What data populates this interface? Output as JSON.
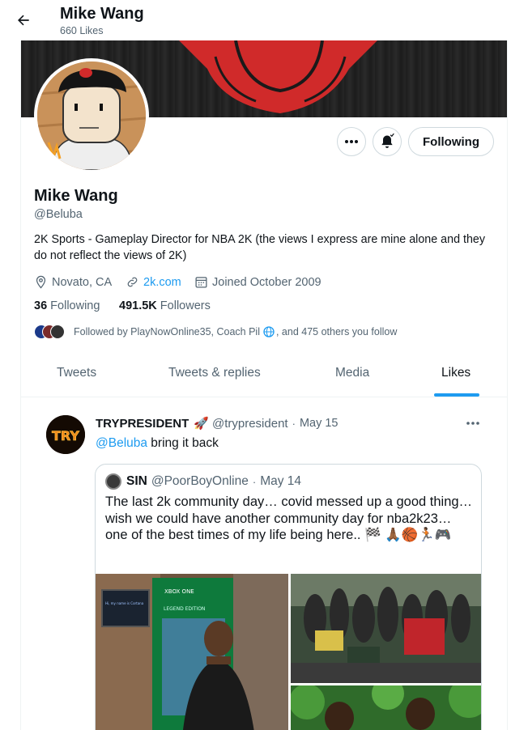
{
  "header": {
    "title": "Mike Wang",
    "likes_count": "660 Likes"
  },
  "profile": {
    "name": "Mike Wang",
    "handle": "@Beluba",
    "bio": "2K Sports - Gameplay Director for NBA 2K (the views I express are mine alone and they do not reflect the views of 2K)",
    "location": "Novato, CA",
    "website": "2k.com",
    "joined": "Joined October 2009",
    "following_count": "36",
    "following_label": "Following",
    "followers_count": "491.5K",
    "followers_label": "Followers",
    "followed_by": "Followed by PlayNowOnline35, Coach Pil",
    "followed_by_tail": ", and 475 others you follow",
    "follow_button_label": "Following"
  },
  "tabs": [
    {
      "label": "Tweets",
      "active": false
    },
    {
      "label": "Tweets & replies",
      "active": false
    },
    {
      "label": "Media",
      "active": false
    },
    {
      "label": "Likes",
      "active": true
    }
  ],
  "tweet": {
    "author_name": "TRYPRESIDENT",
    "author_handle": "@trypresident",
    "separator": "·",
    "date": "May 15",
    "mention": "@Beluba",
    "text": " bring it back",
    "avatar_text": "TRY",
    "quote": {
      "author_name": "SIN",
      "author_handle": "@PoorBoyOnline",
      "separator": "·",
      "date": "May 14",
      "text": "The last 2k community day… covid messed up a good thing… wish we could have another community day for nba2k23… one of the best times of my life being here.. 🏁 🙏🏾🏀🏃🏾🎮",
      "sign_text": "XBOX ONE",
      "sign_title": "LEGEND EDITION",
      "screen_text": "Hi, my name is Cortana"
    }
  },
  "colors": {
    "accent": "#1d9bf0",
    "text": "#0f1419",
    "secondary": "#536471",
    "border": "#cfd9de"
  }
}
